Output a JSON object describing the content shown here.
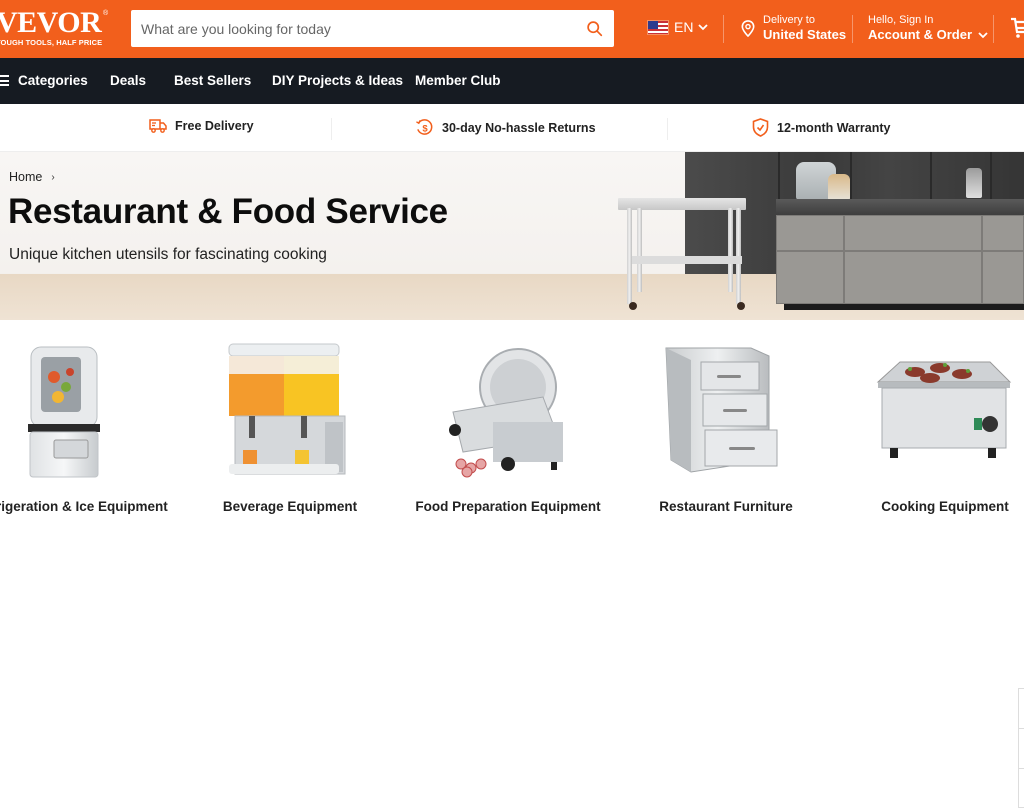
{
  "header": {
    "logo_text": "VEVOR",
    "logo_registered": "®",
    "logo_tagline": "TOUGH TOOLS, HALF PRICE",
    "search_placeholder": "What are you looking for today",
    "search_value": "",
    "language": "EN",
    "delivery_label": "Delivery to",
    "delivery_country": "United States",
    "account_greeting": "Hello, Sign In",
    "account_label": "Account & Order",
    "brand_color": "#f25f1c"
  },
  "nav": {
    "items": [
      {
        "label": "Categories"
      },
      {
        "label": "Deals"
      },
      {
        "label": "Best Sellers"
      },
      {
        "label": "DIY Projects & Ideas"
      },
      {
        "label": "Member Club"
      }
    ]
  },
  "benefits": [
    {
      "icon": "truck-icon",
      "label": "Free Delivery"
    },
    {
      "icon": "returns-icon",
      "label": "30-day No-hassle Returns"
    },
    {
      "icon": "shield-check-icon",
      "label": "12-month Warranty"
    }
  ],
  "hero": {
    "breadcrumb": [
      {
        "label": "Home"
      }
    ],
    "breadcrumb_separator": "›",
    "title": "Restaurant & Food Service",
    "subtitle": "Unique kitchen utensils for fascinating cooking"
  },
  "categories": [
    {
      "label": "Refrigeration & Ice Equipment",
      "image": "blender-image"
    },
    {
      "label": "Beverage Equipment",
      "image": "juice-dispenser-image"
    },
    {
      "label": "Food Preparation Equipment",
      "image": "meat-slicer-image"
    },
    {
      "label": "Restaurant Furniture",
      "image": "drawer-unit-image"
    },
    {
      "label": "Cooking Equipment",
      "image": "griddle-image"
    }
  ]
}
